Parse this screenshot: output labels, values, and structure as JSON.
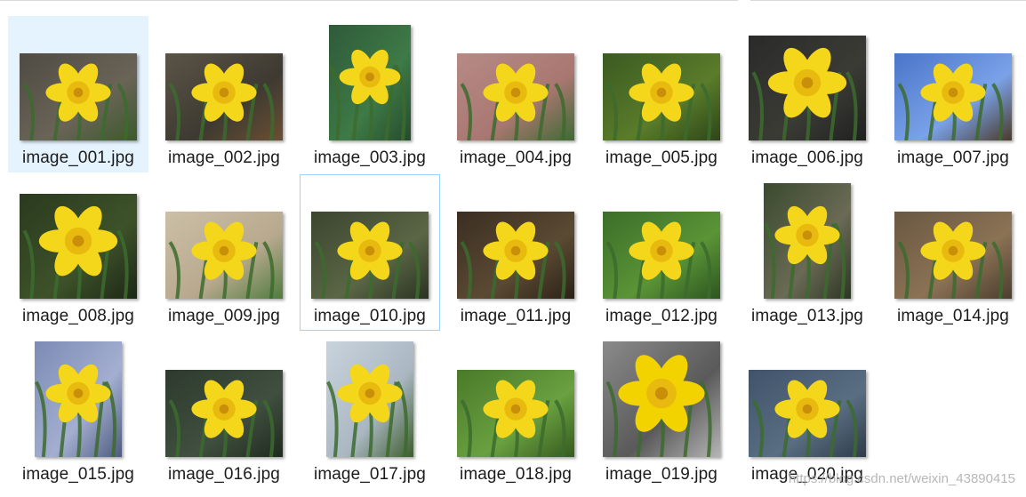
{
  "files": [
    {
      "name": "image_001.jpg",
      "thumb": "A",
      "orient": "landscape",
      "selected": true
    },
    {
      "name": "image_002.jpg",
      "thumb": "B",
      "orient": "landscape"
    },
    {
      "name": "image_003.jpg",
      "thumb": "C",
      "orient": "portrait"
    },
    {
      "name": "image_004.jpg",
      "thumb": "D",
      "orient": "landscape"
    },
    {
      "name": "image_005.jpg",
      "thumb": "E",
      "orient": "landscape"
    },
    {
      "name": "image_006.jpg",
      "thumb": "F",
      "orient": "landscape-tall"
    },
    {
      "name": "image_007.jpg",
      "thumb": "G",
      "orient": "landscape"
    },
    {
      "name": "image_008.jpg",
      "thumb": "H",
      "orient": "landscape-tall"
    },
    {
      "name": "image_009.jpg",
      "thumb": "I",
      "orient": "landscape"
    },
    {
      "name": "image_010.jpg",
      "thumb": "J",
      "orient": "landscape",
      "focused": true
    },
    {
      "name": "image_011.jpg",
      "thumb": "K",
      "orient": "landscape"
    },
    {
      "name": "image_012.jpg",
      "thumb": "L",
      "orient": "landscape"
    },
    {
      "name": "image_013.jpg",
      "thumb": "M",
      "orient": "portrait-wide"
    },
    {
      "name": "image_014.jpg",
      "thumb": "N",
      "orient": "landscape"
    },
    {
      "name": "image_015.jpg",
      "thumb": "O",
      "orient": "portrait-wide"
    },
    {
      "name": "image_016.jpg",
      "thumb": "P",
      "orient": "landscape"
    },
    {
      "name": "image_017.jpg",
      "thumb": "Q",
      "orient": "portrait-wide"
    },
    {
      "name": "image_018.jpg",
      "thumb": "R",
      "orient": "landscape"
    },
    {
      "name": "image_019.jpg",
      "thumb": "S",
      "orient": "portrait-wide-gray"
    },
    {
      "name": "image_020.jpg",
      "thumb": "T",
      "orient": "landscape"
    }
  ],
  "watermark": "https://blog.csdn.net/weixin_43890415",
  "colors": {
    "selection": "#e5f3ff",
    "focus_border": "#99d1ff",
    "petal": "#f4d61a",
    "trumpet": "#e8b90f",
    "leaf": "#3c6b2e"
  }
}
